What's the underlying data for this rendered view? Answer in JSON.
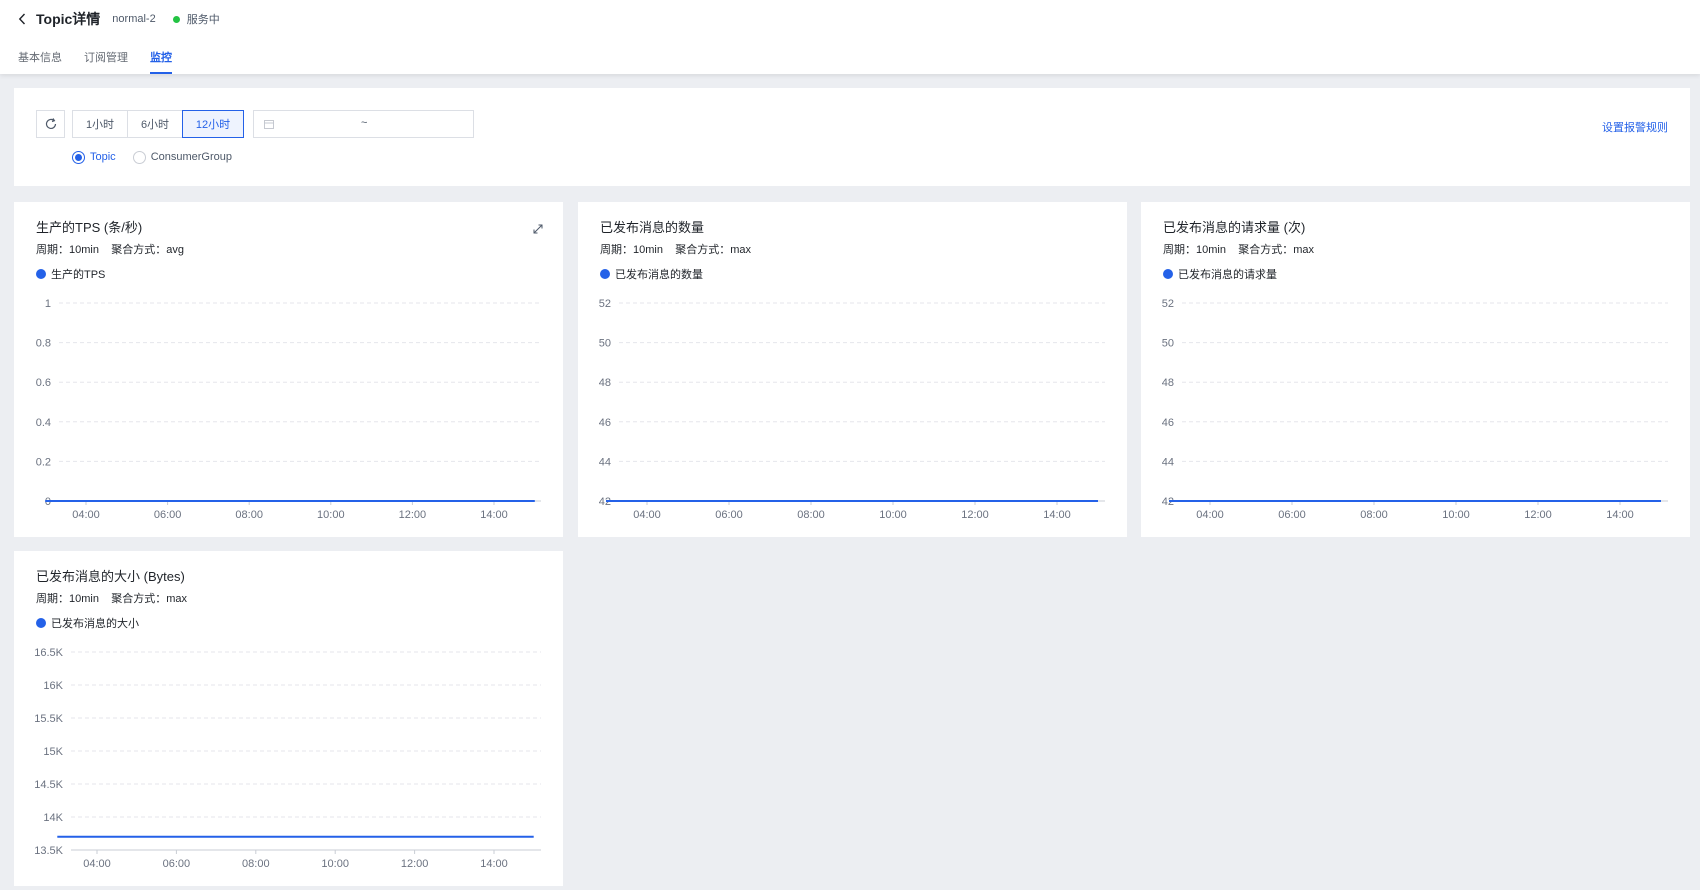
{
  "header": {
    "title": "Topic详情",
    "instance": "normal-2",
    "status": "服务中",
    "status_color": "#23c343",
    "tabs": [
      {
        "label": "基本信息",
        "active": false
      },
      {
        "label": "订阅管理",
        "active": false
      },
      {
        "label": "监控",
        "active": true
      }
    ]
  },
  "toolbar": {
    "ranges": [
      "1小时",
      "6小时",
      "12小时"
    ],
    "active_range": "12小时",
    "date_separator": "~",
    "alarm_link": "设置报警规则",
    "dimensions": [
      {
        "label": "Topic",
        "checked": true
      },
      {
        "label": "ConsumerGroup",
        "checked": false
      }
    ]
  },
  "accent_color": "#2461e8",
  "chart_data": [
    {
      "type": "line",
      "title": "生产的TPS (条/秒)",
      "period_label": "周期：",
      "period": "10min",
      "agg_label": "聚合方式：",
      "agg": "avg",
      "series": [
        {
          "name": "生产的TPS",
          "color": "#2461e8",
          "values": [
            0,
            0
          ]
        }
      ],
      "x": [
        "03:00",
        "15:00"
      ],
      "x_ticks": [
        "04:00",
        "06:00",
        "08:00",
        "10:00",
        "12:00",
        "14:00"
      ],
      "y_ticks": [
        "1",
        "0.8",
        "0.6",
        "0.4",
        "0.2",
        "0"
      ],
      "ylim": [
        0,
        1
      ],
      "grid": true
    },
    {
      "type": "line",
      "title": "已发布消息的数量",
      "period_label": "周期：",
      "period": "10min",
      "agg_label": "聚合方式：",
      "agg": "max",
      "series": [
        {
          "name": "已发布消息的数量",
          "color": "#2461e8",
          "values": [
            42,
            42
          ]
        }
      ],
      "x": [
        "03:00",
        "15:00"
      ],
      "x_ticks": [
        "04:00",
        "06:00",
        "08:00",
        "10:00",
        "12:00",
        "14:00"
      ],
      "y_ticks": [
        "52",
        "50",
        "48",
        "46",
        "44",
        "42"
      ],
      "ylim": [
        42,
        52
      ],
      "grid": true
    },
    {
      "type": "line",
      "title": "已发布消息的请求量 (次)",
      "period_label": "周期：",
      "period": "10min",
      "agg_label": "聚合方式：",
      "agg": "max",
      "series": [
        {
          "name": "已发布消息的请求量",
          "color": "#2461e8",
          "values": [
            42,
            42
          ]
        }
      ],
      "x": [
        "03:00",
        "15:00"
      ],
      "x_ticks": [
        "04:00",
        "06:00",
        "08:00",
        "10:00",
        "12:00",
        "14:00"
      ],
      "y_ticks": [
        "52",
        "50",
        "48",
        "46",
        "44",
        "42"
      ],
      "ylim": [
        42,
        52
      ],
      "grid": true
    },
    {
      "type": "line",
      "title": "已发布消息的大小 (Bytes)",
      "period_label": "周期：",
      "period": "10min",
      "agg_label": "聚合方式：",
      "agg": "max",
      "series": [
        {
          "name": "已发布消息的大小",
          "color": "#2461e8",
          "values": [
            13700,
            13700
          ]
        }
      ],
      "x": [
        "03:00",
        "15:00"
      ],
      "x_ticks": [
        "04:00",
        "06:00",
        "08:00",
        "10:00",
        "12:00",
        "14:00"
      ],
      "y_ticks": [
        "16.5K",
        "16K",
        "15.5K",
        "15K",
        "14.5K",
        "14K",
        "13.5K"
      ],
      "ylim": [
        13500,
        16500
      ],
      "grid": true
    }
  ]
}
